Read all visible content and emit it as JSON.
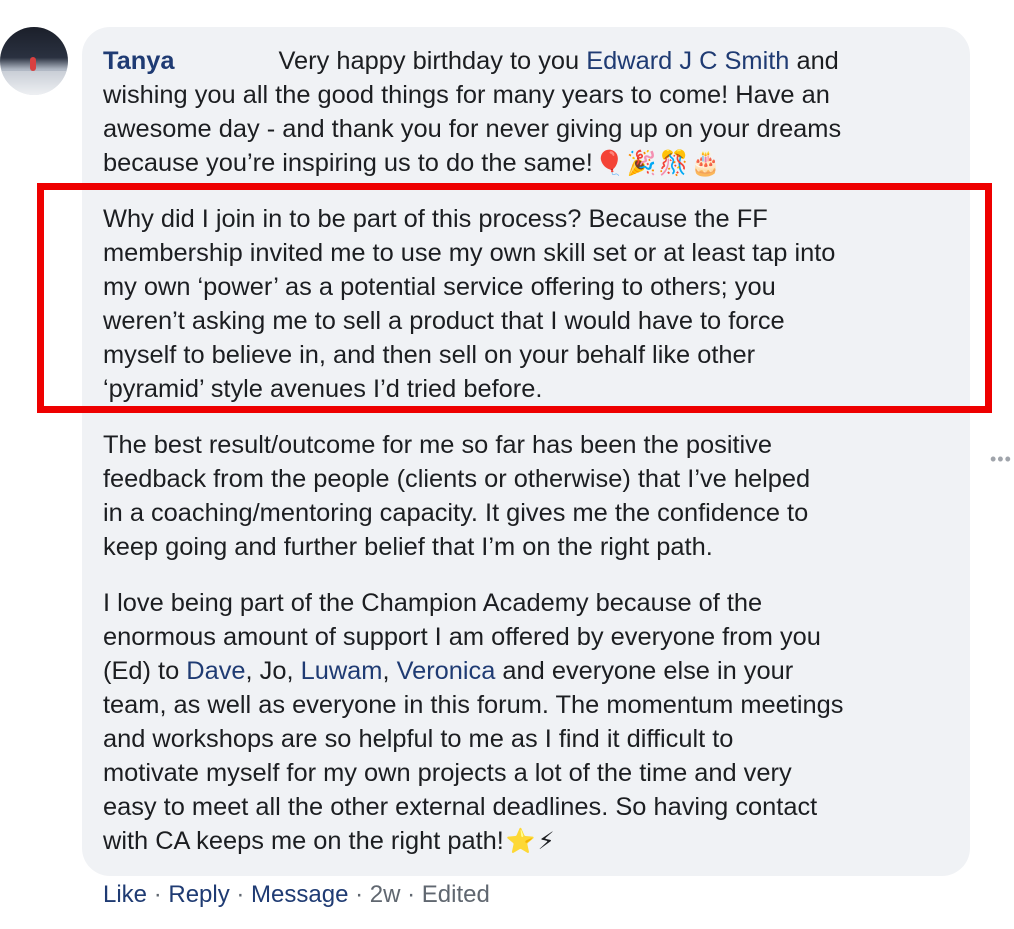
{
  "comment": {
    "author": "Tanya",
    "p1": {
      "t1": "Very happy birthday to you ",
      "mention": "Edward J C Smith",
      "t2": " and",
      "l2": "wishing you all the good things for many years to come! Have an",
      "l3": "awesome day - and thank you for never giving up on your dreams",
      "l4": "because you’re inspiring us to do the same!",
      "emojis": [
        "🎈",
        "🎉",
        "🎊",
        "🎂"
      ]
    },
    "p2": {
      "l1": "Why did I join in to be part of this process? Because the FF",
      "l2": "membership invited me to use my own skill set or at least tap into",
      "l3": "my own ‘power’ as a potential service offering to others; you",
      "l4": "weren’t asking me to sell a product that I would have to force",
      "l5": "myself to believe in, and then sell on your behalf like other",
      "l6": "‘pyramid’ style avenues I’d tried before."
    },
    "p3": {
      "l1": "The best result/outcome for me so far has been the positive",
      "l2": "feedback from the people (clients or otherwise) that I’ve helped",
      "l3": "in a coaching/mentoring capacity. It gives me the confidence to",
      "l4": "keep going and further belief that I’m on the right path."
    },
    "p4": {
      "l1": "I love being part of the Champion Academy because of the",
      "l2": "enormous amount of support I am offered by everyone from you",
      "l3a": "(Ed) to ",
      "m1": "Dave",
      "l3b": ", Jo, ",
      "m2": "Luwam",
      "l3c": ", ",
      "m3": "Veronica",
      "l3d": " and everyone else in your",
      "l4": "team, as well as everyone in this forum. The momentum meetings",
      "l5": "and workshops are so helpful to me as I find it difficult to",
      "l6": "motivate myself for my own projects a lot of the time and very",
      "l7": "easy to meet all the other external deadlines. So having contact",
      "l8": "with CA keeps me on the right path!",
      "emojis": [
        "⭐",
        "⚡"
      ]
    }
  },
  "actions": {
    "like": "Like",
    "reply": "Reply",
    "message": "Message",
    "sep": " · ",
    "time": "2w",
    "edited": "Edited"
  },
  "icons": {
    "more": "more-options-icon"
  },
  "colors": {
    "bubble": "#f0f2f5",
    "link": "#1f3b73",
    "highlight": "#ee0000",
    "meta": "#606770"
  }
}
